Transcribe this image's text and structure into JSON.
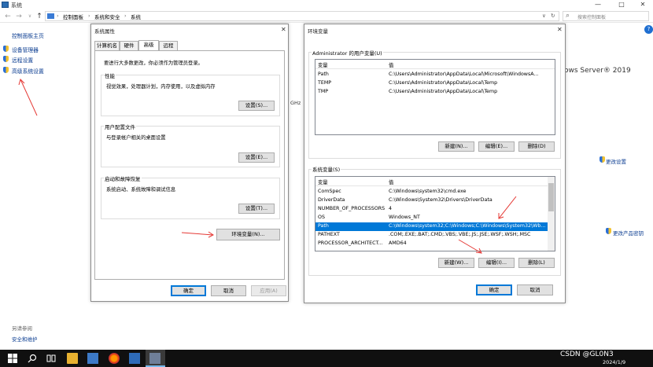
{
  "window": {
    "title": "系统",
    "controls": {
      "minimize": "—",
      "maximize": "□",
      "close": "✕"
    }
  },
  "nav": {
    "back": "←",
    "forward": "→",
    "down": "∨",
    "up": "↑"
  },
  "breadcrumb": [
    "控制面板",
    "系统和安全",
    "系统"
  ],
  "breadcrumb_sep": "›",
  "addr_dropdown": "∨",
  "refresh": "↻",
  "search": {
    "placeholder": "搜索控制面板",
    "icon": "⌕"
  },
  "sidebar": {
    "home": "控制面板主页",
    "items": [
      {
        "label": "设备管理器",
        "icon": "shield-icon"
      },
      {
        "label": "远程设置",
        "icon": "shield-icon"
      },
      {
        "label": "高级系统设置",
        "icon": "shield-icon"
      }
    ],
    "see_also": "另请参阅",
    "security": "安全和维护"
  },
  "main": {
    "os_edition": "ows Server® 2019",
    "ghz": "GHz",
    "change_settings": "更改设置",
    "change_product_key": "更改产品密钥"
  },
  "help_button": "?",
  "system_properties": {
    "title": "系统属性",
    "close": "✕",
    "tabs": [
      "计算机名",
      "硬件",
      "高级",
      "远程"
    ],
    "active_tab": 2,
    "admin_note": "要进行大多数更改，你必须作为管理员登录。",
    "groups": [
      {
        "title": "性能",
        "desc": "视觉效果，处理器计划，内存使用，以及虚拟内存",
        "button": "设置(S)..."
      },
      {
        "title": "用户配置文件",
        "desc": "与登录帐户相关的桌面设置",
        "button": "设置(E)..."
      },
      {
        "title": "启动和故障恢复",
        "desc": "系统启动、系统故障和调试信息",
        "button": "设置(T)..."
      }
    ],
    "env_button": "环境变量(N)...",
    "ok": "确定",
    "cancel": "取消",
    "apply": "应用(A)"
  },
  "env_vars": {
    "title": "环境变量",
    "close": "✕",
    "user_section": "Administrator 的用户变量(U)",
    "col_var": "变量",
    "col_val": "值",
    "user_vars": [
      {
        "name": "Path",
        "value": "C:\\Users\\Administrator\\AppData\\Local\\Microsoft\\WindowsA..."
      },
      {
        "name": "TEMP",
        "value": "C:\\Users\\Administrator\\AppData\\Local\\Temp"
      },
      {
        "name": "TMP",
        "value": "C:\\Users\\Administrator\\AppData\\Local\\Temp"
      }
    ],
    "user_buttons": [
      "新建(N)...",
      "编辑(E)...",
      "删除(D)"
    ],
    "sys_section": "系统变量(S)",
    "sys_vars": [
      {
        "name": "ComSpec",
        "value": "C:\\Windows\\system32\\cmd.exe"
      },
      {
        "name": "DriverData",
        "value": "C:\\Windows\\System32\\Drivers\\DriverData"
      },
      {
        "name": "NUMBER_OF_PROCESSORS",
        "value": "4"
      },
      {
        "name": "OS",
        "value": "Windows_NT"
      },
      {
        "name": "Path",
        "value": "C:\\Windows\\system32;C:\\Windows;C:\\Windows\\System32\\Wb..."
      },
      {
        "name": "PATHEXT",
        "value": ".COM;.EXE;.BAT;.CMD;.VBS;.VBE;.JS;.JSE;.WSF;.WSH;.MSC"
      },
      {
        "name": "PROCESSOR_ARCHITECT...",
        "value": "AMD64"
      }
    ],
    "selected_sys_index": 4,
    "sys_buttons": [
      "新建(W)...",
      "编辑(I)...",
      "删除(L)"
    ],
    "ok": "确定",
    "cancel": "取消"
  },
  "taskbar": {
    "watermark": "CSDN @GL0N3",
    "date": "2024/1/9"
  },
  "colors": {
    "accent": "#0078d7",
    "annotation_arrow": "#e53935"
  }
}
